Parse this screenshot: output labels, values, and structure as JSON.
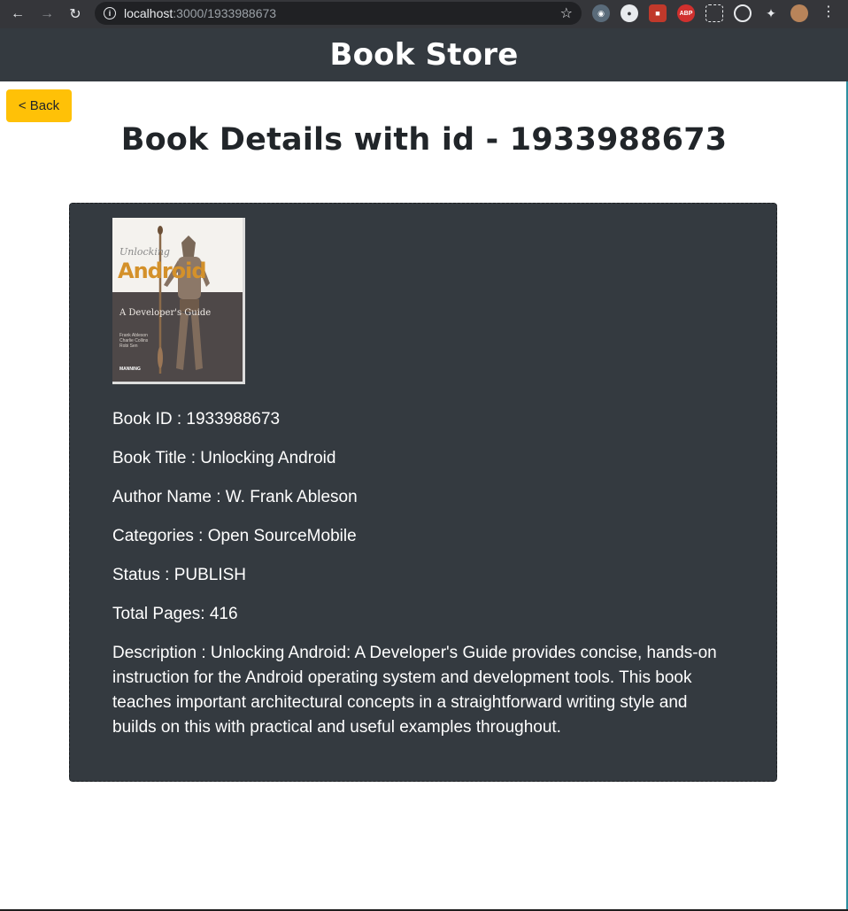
{
  "browser": {
    "url_host": "localhost",
    "url_path": ":3000/1933988673",
    "extensions": [
      "eyes-extension-icon",
      "circle-extension-icon",
      "red-extension-icon",
      "adblock-plus-icon",
      "screenshot-icon",
      "target-icon",
      "puzzle-icon",
      "profile-avatar"
    ],
    "abp_label": "ABP"
  },
  "header": {
    "title": "Book Store"
  },
  "back_button": {
    "label": "< Back"
  },
  "page": {
    "title": "Book Details with id - 1933988673"
  },
  "cover": {
    "line1": "Unlocking",
    "line2": "Android",
    "line3": "A Developer's Guide",
    "authors": "Frank Ableson\nCharlie Collins\nRobi Sen",
    "publisher": "MANNING"
  },
  "book": {
    "id_line": "Book ID : 1933988673",
    "title_line": "Book Title : Unlocking Android",
    "author_line": "Author Name : W. Frank Ableson",
    "categories_line": "Categories : Open SourceMobile",
    "status_line": "Status : PUBLISH",
    "pages_line": "Total Pages: 416",
    "description_line": "Description : Unlocking Android: A Developer's Guide provides concise, hands-on instruction for the Android operating system and development tools. This book teaches important architectural concepts in a straightforward writing style and builds on this with practical and useful examples throughout."
  },
  "colors": {
    "header_bg": "#343a40",
    "card_bg": "#343a40",
    "back_button_bg": "#ffc107",
    "text_light": "#ffffff",
    "text_dark": "#212529"
  }
}
